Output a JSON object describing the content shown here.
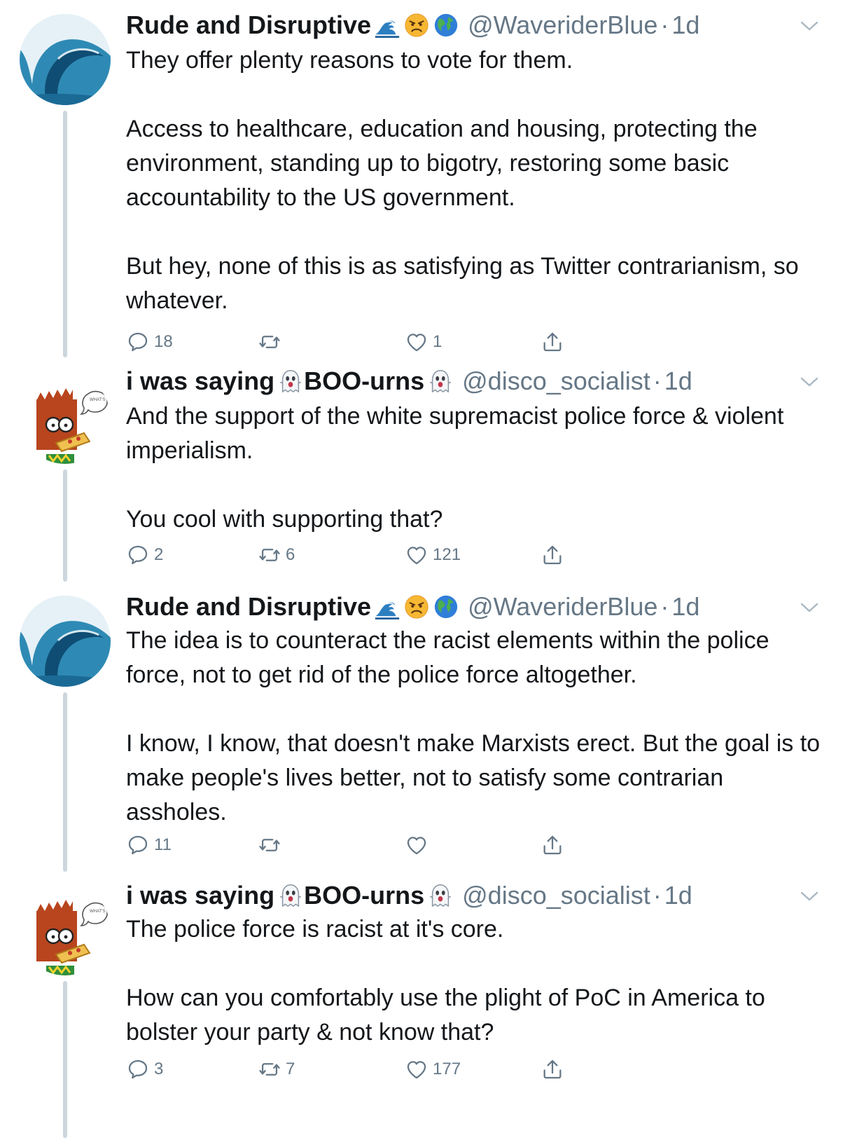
{
  "tweets": [
    {
      "name": "Rude and Disruptive",
      "handle": "@WaveriderBlue",
      "time": "1d",
      "text": "They offer plenty reasons to vote for them.\n\nAccess to healthcare, education and housing, protecting the environment, standing up to bigotry, restoring some basic accountability to the US government.\n\nBut hey, none of this is as satisfying as Twitter contrarianism, so whatever.",
      "replies": "18",
      "retweets": "",
      "likes": "1"
    },
    {
      "name": "i was saying",
      "name_suffix": "BOO-urns",
      "handle": "@disco_socialist",
      "time": "1d",
      "text": "And the support of the white supremacist police force & violent imperialism.\n\nYou cool with supporting that?",
      "replies": "2",
      "retweets": "6",
      "likes": "121"
    },
    {
      "name": "Rude and Disruptive",
      "handle": "@WaveriderBlue",
      "time": "1d",
      "text": "The idea is to counteract the racist elements within the police force, not to get rid of the police force altogether.\n\nI know, I know, that doesn't make Marxists erect. But the goal is to make people's lives better, not to satisfy some contrarian assholes.",
      "replies": "11",
      "retweets": "",
      "likes": ""
    },
    {
      "name": "i was saying",
      "name_suffix": "BOO-urns",
      "handle": "@disco_socialist",
      "time": "1d",
      "text": "The police force is racist at it's core.\n\nHow can you comfortably use the plight of PoC in America to bolster your party & not know that?",
      "replies": "3",
      "retweets": "7",
      "likes": "177"
    }
  ],
  "separator": "·",
  "avatar_text": "WHAT'S",
  "icons": {
    "reply": "reply-icon",
    "retweet": "retweet-icon",
    "like": "heart-icon",
    "share": "share-icon",
    "caret": "chevron-down-icon",
    "wave": "wave-emoji-icon",
    "angry": "angry-face-emoji-icon",
    "globe": "globe-emoji-icon",
    "ghost": "ghost-emoji-icon"
  },
  "colors": {
    "text": "#14171a",
    "secondary": "#657786",
    "thread": "#ccd6dd"
  }
}
